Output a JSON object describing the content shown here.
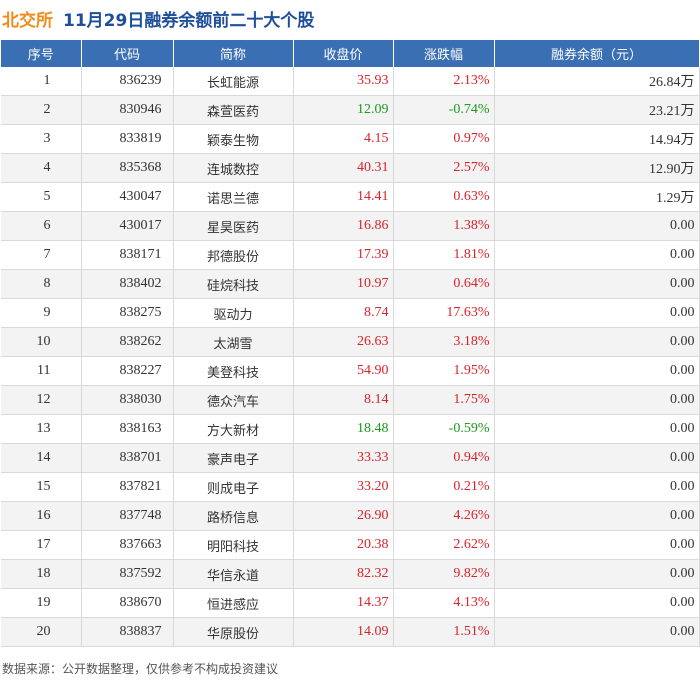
{
  "header": {
    "brand": "北交所",
    "title": "11月29日融券余额前二十大个股"
  },
  "columns": [
    "序号",
    "代码",
    "简称",
    "收盘价",
    "涨跌幅",
    "融券余额（元）"
  ],
  "rows": [
    {
      "idx": "1",
      "code": "836239",
      "name": "长虹能源",
      "close": "35.93",
      "change": "2.13%",
      "balance": "26.84万",
      "dir": "up"
    },
    {
      "idx": "2",
      "code": "830946",
      "name": "森萱医药",
      "close": "12.09",
      "change": "-0.74%",
      "balance": "23.21万",
      "dir": "down"
    },
    {
      "idx": "3",
      "code": "833819",
      "name": "颖泰生物",
      "close": "4.15",
      "change": "0.97%",
      "balance": "14.94万",
      "dir": "up"
    },
    {
      "idx": "4",
      "code": "835368",
      "name": "连城数控",
      "close": "40.31",
      "change": "2.57%",
      "balance": "12.90万",
      "dir": "up"
    },
    {
      "idx": "5",
      "code": "430047",
      "name": "诺思兰德",
      "close": "14.41",
      "change": "0.63%",
      "balance": "1.29万",
      "dir": "up"
    },
    {
      "idx": "6",
      "code": "430017",
      "name": "星昊医药",
      "close": "16.86",
      "change": "1.38%",
      "balance": "0.00",
      "dir": "up"
    },
    {
      "idx": "7",
      "code": "838171",
      "name": "邦德股份",
      "close": "17.39",
      "change": "1.81%",
      "balance": "0.00",
      "dir": "up"
    },
    {
      "idx": "8",
      "code": "838402",
      "name": "硅烷科技",
      "close": "10.97",
      "change": "0.64%",
      "balance": "0.00",
      "dir": "up"
    },
    {
      "idx": "9",
      "code": "838275",
      "name": "驱动力",
      "close": "8.74",
      "change": "17.63%",
      "balance": "0.00",
      "dir": "up"
    },
    {
      "idx": "10",
      "code": "838262",
      "name": "太湖雪",
      "close": "26.63",
      "change": "3.18%",
      "balance": "0.00",
      "dir": "up"
    },
    {
      "idx": "11",
      "code": "838227",
      "name": "美登科技",
      "close": "54.90",
      "change": "1.95%",
      "balance": "0.00",
      "dir": "up"
    },
    {
      "idx": "12",
      "code": "838030",
      "name": "德众汽车",
      "close": "8.14",
      "change": "1.75%",
      "balance": "0.00",
      "dir": "up"
    },
    {
      "idx": "13",
      "code": "838163",
      "name": "方大新材",
      "close": "18.48",
      "change": "-0.59%",
      "balance": "0.00",
      "dir": "down"
    },
    {
      "idx": "14",
      "code": "838701",
      "name": "豪声电子",
      "close": "33.33",
      "change": "0.94%",
      "balance": "0.00",
      "dir": "up"
    },
    {
      "idx": "15",
      "code": "837821",
      "name": "则成电子",
      "close": "33.20",
      "change": "0.21%",
      "balance": "0.00",
      "dir": "up"
    },
    {
      "idx": "16",
      "code": "837748",
      "name": "路桥信息",
      "close": "26.90",
      "change": "4.26%",
      "balance": "0.00",
      "dir": "up"
    },
    {
      "idx": "17",
      "code": "837663",
      "name": "明阳科技",
      "close": "20.38",
      "change": "2.62%",
      "balance": "0.00",
      "dir": "up"
    },
    {
      "idx": "18",
      "code": "837592",
      "name": "华信永道",
      "close": "82.32",
      "change": "9.82%",
      "balance": "0.00",
      "dir": "up"
    },
    {
      "idx": "19",
      "code": "838670",
      "name": "恒进感应",
      "close": "14.37",
      "change": "4.13%",
      "balance": "0.00",
      "dir": "up"
    },
    {
      "idx": "20",
      "code": "838837",
      "name": "华原股份",
      "close": "14.09",
      "change": "1.51%",
      "balance": "0.00",
      "dir": "up"
    }
  ],
  "footer": "数据来源：公开数据整理，仅供参考不构成投资建议",
  "colors": {
    "brand": "#f08c1e",
    "title": "#1f4f9a",
    "header_bg": "#3b6fb3",
    "up": "#d8232a",
    "down": "#1b9a1b"
  }
}
